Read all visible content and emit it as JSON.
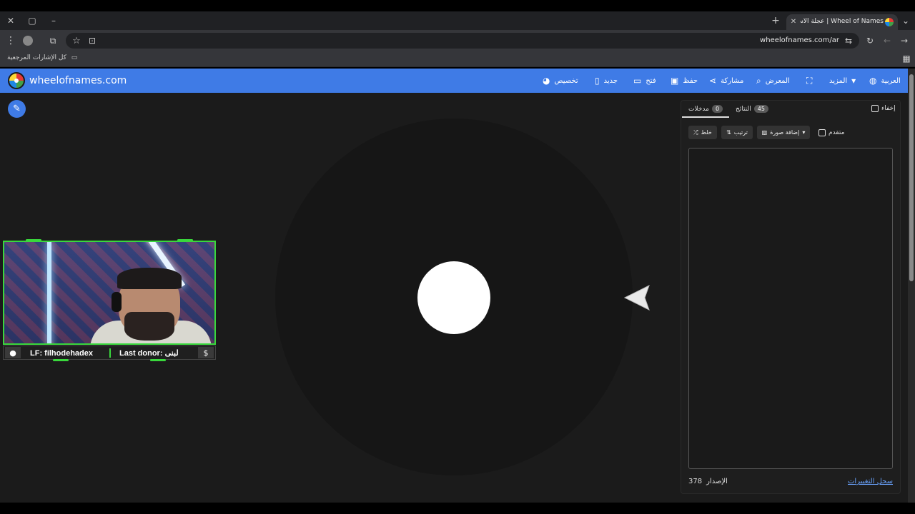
{
  "browser": {
    "tab_title": "Wheel of Names | عجلة الاسم العشوائي",
    "url": "wheelofnames.com/ar",
    "bookmarks_label": "كل الإشارات المرجعية",
    "window_icons": {
      "close": "✕",
      "restore": "▢",
      "minimize": "–",
      "new_tab": "+",
      "tab_close": "✕",
      "tab_menu": "⌄"
    },
    "toolbar_icons": {
      "menu": "⋮",
      "extensions": "⧉",
      "star": "☆",
      "reload": "↻",
      "back": "←",
      "forward": "→",
      "tune": "⇆",
      "cast": "⊡"
    }
  },
  "app": {
    "brand": "wheelofnames.com",
    "menu": {
      "language": "العربية",
      "more": "المزيد",
      "gallery": "المعرض",
      "share": "مشاركة",
      "save": "حفظ",
      "open": "فتح",
      "new": "جديد",
      "customize": "تخصيص"
    }
  },
  "webcam_overlay": {
    "lf_text": "LF: filhodehadex",
    "donor_text": "Last donor: لبنى",
    "dollar": "$"
  },
  "panel": {
    "hide_label": "إخفاء",
    "results_tab": {
      "label": "النتائج",
      "count": "45"
    },
    "entries_tab": {
      "label": "مدخلات",
      "count": "0"
    },
    "advanced_label": "متقدم",
    "add_image_label": "إضافة صورة",
    "sort_label": "ترتيب",
    "shuffle_label": "خلط",
    "version_label": "الإصدار",
    "version_number": "378",
    "changelog_label": "سجل التغييرات"
  },
  "colors": {
    "appbar": "#3f7be6",
    "background": "#1b1b1b",
    "webcam_border": "#39d83c",
    "link": "#6aa4ff"
  }
}
